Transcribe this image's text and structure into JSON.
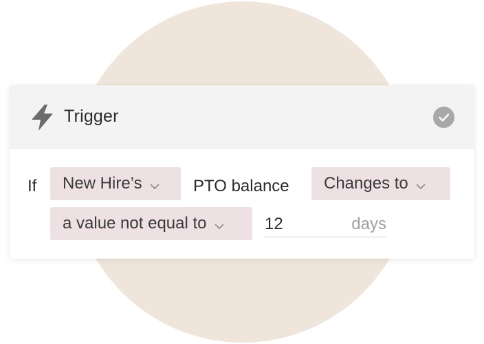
{
  "header": {
    "title": "Trigger",
    "icon": "lightning-bolt-icon",
    "status_icon": "check-circle-icon"
  },
  "condition": {
    "if_label": "If",
    "subject": "New Hire’s",
    "field_label": "PTO balance",
    "event": "Changes to",
    "operator": "a value not equal to",
    "value": "12",
    "unit": "days"
  },
  "colors": {
    "background_circle": "#efe5db",
    "header_bg": "#f3f3f3",
    "chip_bg": "#eee1e3",
    "check_badge": "#a8a8a8"
  }
}
